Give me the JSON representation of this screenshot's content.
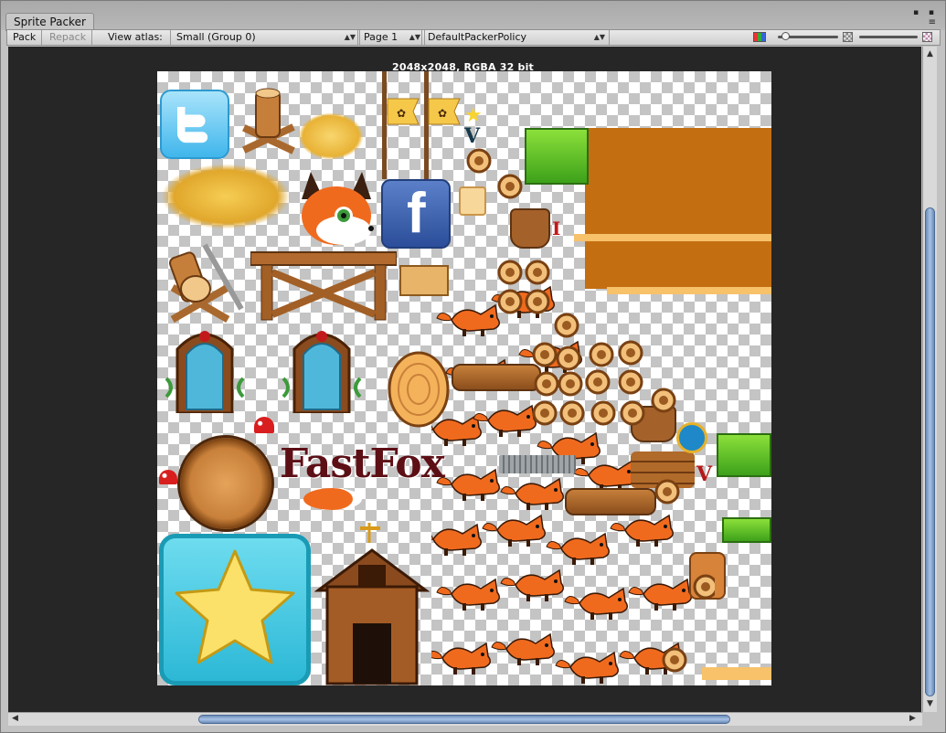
{
  "window": {
    "tab_title": "Sprite Packer",
    "window_buttons": "▪ ▪",
    "close_glyph": "≡"
  },
  "toolbar": {
    "pack_label": "Pack",
    "repack_label": "Repack",
    "view_atlas_label": "View atlas:",
    "atlas_select": "Small (Group 0)",
    "page_select": "Page 1",
    "policy_select": "DefaultPackerPolicy"
  },
  "viewport": {
    "atlas_info": "2048x2048, RGBA 32 bit"
  },
  "sprites": {
    "facebook_letter": "f",
    "fastfox_title": "FastFox",
    "v_letter": "V",
    "i_letter": "I"
  },
  "colors": {
    "viewport_bg": "#262626",
    "scroll_thumb": "#8aa8d0",
    "toolbar_bg": "#dcdcdc"
  }
}
